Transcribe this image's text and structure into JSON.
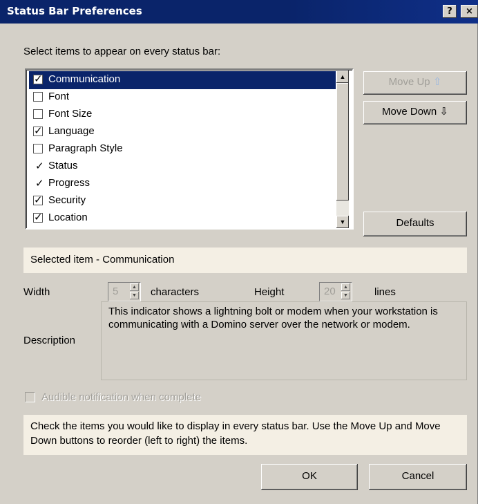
{
  "window": {
    "title": "Status Bar Preferences",
    "help_glyph": "?",
    "close_glyph": "×"
  },
  "list": {
    "prompt": "Select items to appear on every status bar:",
    "items": [
      {
        "label": "Communication",
        "state": "checked",
        "selected": true
      },
      {
        "label": "Font",
        "state": "unchecked",
        "selected": false
      },
      {
        "label": "Font Size",
        "state": "unchecked",
        "selected": false
      },
      {
        "label": "Language",
        "state": "checked",
        "selected": false
      },
      {
        "label": "Paragraph Style",
        "state": "unchecked",
        "selected": false
      },
      {
        "label": "Status",
        "state": "tick",
        "selected": false
      },
      {
        "label": "Progress",
        "state": "tick",
        "selected": false
      },
      {
        "label": "Security",
        "state": "checked",
        "selected": false
      },
      {
        "label": "Location",
        "state": "checked",
        "selected": false
      }
    ]
  },
  "buttons": {
    "move_up": "Move Up",
    "move_up_arrow": "⇧",
    "move_down": "Move Down",
    "move_down_arrow": "⇩",
    "defaults": "Defaults",
    "ok": "OK",
    "cancel": "Cancel"
  },
  "selected_item": "Selected item - Communication",
  "width": {
    "label": "Width",
    "value": "5",
    "unit": "characters"
  },
  "height": {
    "label": "Height",
    "value": "20",
    "unit": "lines"
  },
  "description": {
    "label": "Description",
    "text": "This indicator shows a lightning bolt or modem when your workstation is communicating with a Domino server over the network or modem."
  },
  "audible": {
    "label": "Audible notification when complete",
    "checked": false,
    "enabled": false
  },
  "help_text": "Check the items you would like to display in every status bar.  Use the Move Up and Move Down buttons to reorder (left to right) the items."
}
